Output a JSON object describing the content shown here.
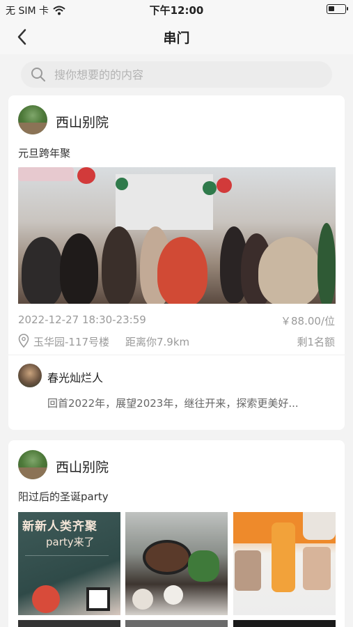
{
  "status_bar": {
    "carrier": "无 SIM 卡",
    "time": "下午12:00"
  },
  "nav": {
    "title": "串门"
  },
  "search": {
    "placeholder": "搜你想要的的内容"
  },
  "posts": [
    {
      "shop_name": "西山别院",
      "title": "元旦跨年聚",
      "datetime": "2022-12-27 18:30-23:59",
      "price": "￥88.00/位",
      "location": "玉华园-117号楼",
      "distance": "距离你7.9km",
      "remaining": "剩1名额",
      "comment": {
        "author": "春光灿烂人",
        "text": "回首2022年，展望2023年，继往开来，探索更美好..."
      }
    },
    {
      "shop_name": "西山别院",
      "title": "阳过后的圣诞party",
      "thumb_text": {
        "line1": "新新人类齐聚",
        "line2": "party来了"
      }
    }
  ],
  "colors": {
    "background": "#f3f3f3",
    "card": "#ffffff",
    "muted_text": "#9a9a9a"
  }
}
